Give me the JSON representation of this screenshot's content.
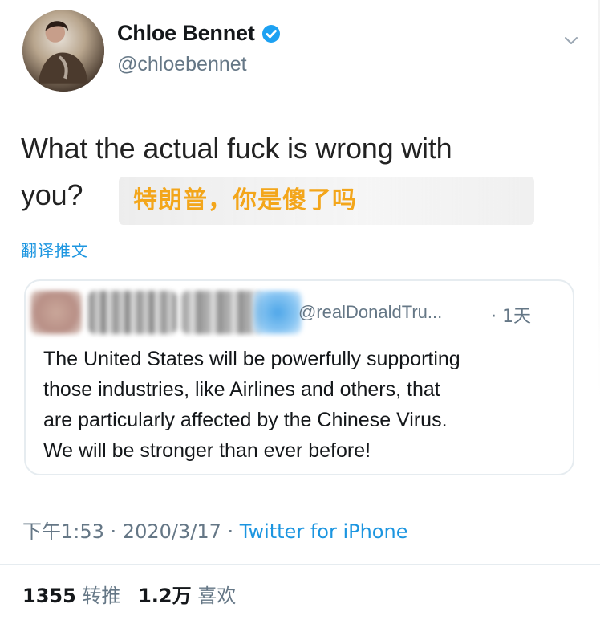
{
  "author": {
    "display_name": "Chloe Bennet",
    "handle": "@chloebennet",
    "verified_icon": "verified-badge-icon",
    "menu_icon": "chevron-down-icon"
  },
  "tweet": {
    "text_line1": "What the actual fuck is wrong with",
    "text_line2": "you?",
    "annotation": "特朗普，你是傻了吗",
    "translate_label": "翻译推文"
  },
  "quoted_tweet": {
    "handle": "@realDonaldTru...",
    "time": "· 1天",
    "lines": [
      "The United States will be powerfully supporting",
      "those industries, like Airlines and others, that",
      "are particularly affected by the Chinese Virus.",
      "We will be stronger than ever before!"
    ]
  },
  "meta": {
    "time": "下午1:53",
    "sep1": " · ",
    "date": "2020/3/17",
    "sep2": " · ",
    "source": "Twitter for iPhone"
  },
  "stats": {
    "retweets_count": "1355",
    "retweets_label": "转推",
    "likes_count": "1.2万",
    "likes_label": "喜欢"
  },
  "colors": {
    "link_blue": "#1b95e0",
    "annotation_orange": "#f3a61b",
    "muted_gray": "#657786",
    "text_dark": "#14171a"
  }
}
